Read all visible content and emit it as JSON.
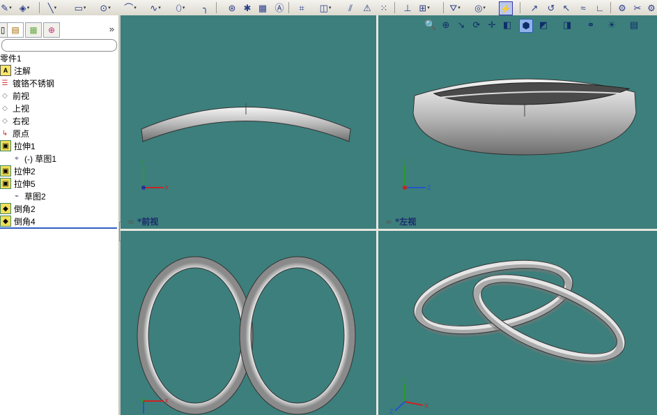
{
  "toolbar": {
    "icons": [
      "sketch-icon",
      "smart-dimension-icon",
      "line-icon",
      "rectangle-icon",
      "circle-icon",
      "arc-icon",
      "spline-icon",
      "ellipse-icon",
      "fillet-sketch-icon",
      "point-icon",
      "centerline-icon",
      "text-icon",
      "mirror-icon",
      "offset-icon",
      "trim-icon",
      "pattern-icon",
      "relations-icon",
      "display-relations-icon",
      "repair-icon",
      "grid-icon",
      "rapid-sketch-icon"
    ]
  },
  "panel": {
    "tabs": [
      "feature-manager-tab",
      "property-manager-tab",
      "configuration-manager-tab",
      "dimxpert-tab"
    ],
    "expand": "»",
    "tree": [
      {
        "label": "零件1",
        "level": 0,
        "icon": "part-icon"
      },
      {
        "label": "注解",
        "level": 0,
        "icon": "annotations-icon"
      },
      {
        "label": "镀铬不锈钢",
        "level": 0,
        "icon": "material-icon"
      },
      {
        "label": "前视",
        "level": 0,
        "icon": "plane-icon"
      },
      {
        "label": "上视",
        "level": 0,
        "icon": "plane-icon"
      },
      {
        "label": "右视",
        "level": 0,
        "icon": "plane-icon"
      },
      {
        "label": "原点",
        "level": 0,
        "icon": "origin-icon"
      },
      {
        "label": "拉伸1",
        "level": 0,
        "icon": "extrude-icon"
      },
      {
        "label": "(-) 草图1",
        "level": 1,
        "icon": "sketch-icon"
      },
      {
        "label": "拉伸2",
        "level": 0,
        "icon": "extrude-icon"
      },
      {
        "label": "拉伸5",
        "level": 0,
        "icon": "extrude-icon"
      },
      {
        "label": "草图2",
        "level": 1,
        "icon": "sketch-icon"
      },
      {
        "label": "倒角2",
        "level": 0,
        "icon": "chamfer-icon"
      },
      {
        "label": "倒角4",
        "level": 0,
        "icon": "chamfer-icon"
      }
    ]
  },
  "viewports": {
    "front": {
      "label": "*前视",
      "axes": [
        "Y",
        "X"
      ]
    },
    "left": {
      "label": "*左视",
      "axes": [
        "Y",
        "Z"
      ]
    },
    "top": {
      "axes": [
        "X"
      ]
    },
    "iso": {
      "axes": [
        "Y",
        "X",
        "Z"
      ]
    }
  },
  "view_toolbar": {
    "icons": [
      "zoom-fit-icon",
      "zoom-area-icon",
      "previous-view-icon",
      "rotate-icon",
      "pan-icon",
      "section-view-icon",
      "view-orientation-icon",
      "display-style-icon",
      "hide-show-icon",
      "edit-appearance-icon",
      "scene-icon",
      "view-settings-icon"
    ]
  },
  "colors": {
    "viewport_bg": "#3d7f7c",
    "accent": "#2b3e8a"
  }
}
